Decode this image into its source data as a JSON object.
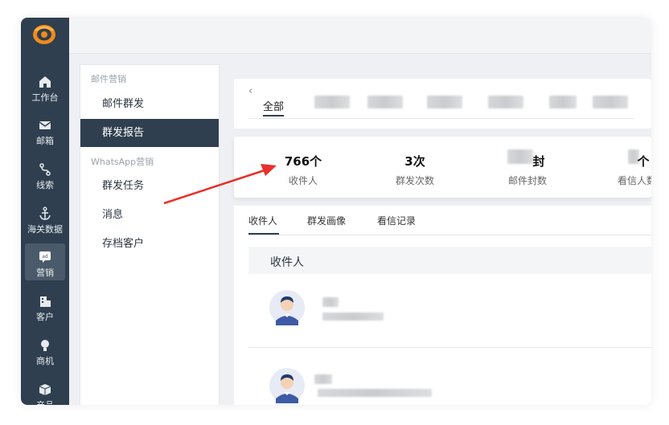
{
  "nav": {
    "items": [
      {
        "label": "工作台",
        "icon": "home-icon"
      },
      {
        "label": "邮箱",
        "icon": "mail-icon"
      },
      {
        "label": "线索",
        "icon": "lead-icon"
      },
      {
        "label": "海关数据",
        "icon": "anchor-icon"
      },
      {
        "label": "营销",
        "icon": "marketing-icon"
      },
      {
        "label": "客户",
        "icon": "building-icon"
      },
      {
        "label": "商机",
        "icon": "bulb-icon"
      },
      {
        "label": "产品",
        "icon": "box-icon"
      }
    ],
    "active": "营销"
  },
  "submenu": {
    "group1": "邮件营销",
    "items1": [
      "邮件群发",
      "群发报告"
    ],
    "group2": "WhatsApp营销",
    "items2": [
      "群发任务",
      "消息",
      "存档客户"
    ],
    "active": "群发报告"
  },
  "tabs_card": {
    "back": "‹",
    "first_tab": "全部"
  },
  "stats": [
    {
      "value": "766个",
      "label": "收件人"
    },
    {
      "value": "3次",
      "label": "群发次数"
    },
    {
      "value": "封",
      "label": "邮件封数"
    },
    {
      "value": "个",
      "label": "看信人数"
    }
  ],
  "main": {
    "tabs": [
      "收件人",
      "群发画像",
      "看信记录"
    ],
    "section_title": "收件人"
  },
  "colors": {
    "nav_bg": "#2f3f4f",
    "accent": "#2f3f4f",
    "annotation_arrow": "#e8302a"
  }
}
